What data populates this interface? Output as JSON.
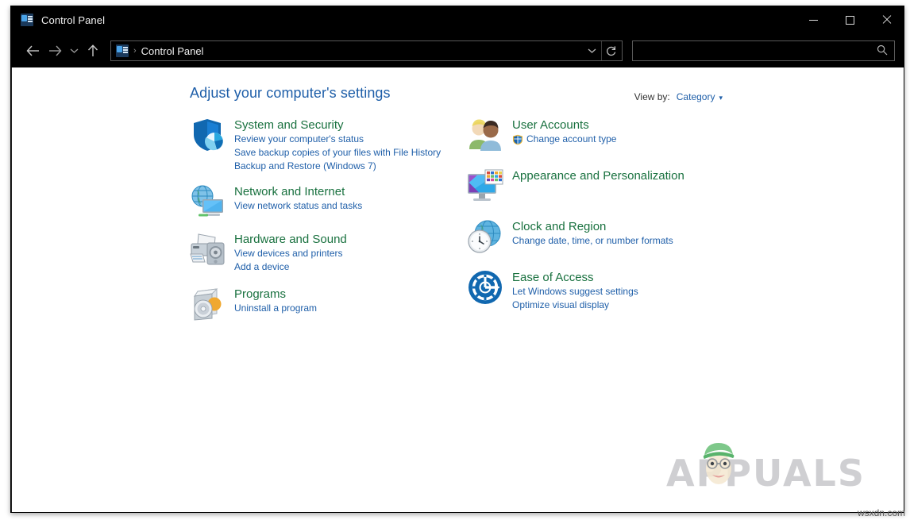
{
  "window": {
    "title": "Control Panel",
    "icon": "control-panel-icon",
    "controls": {
      "minimize": "minimize-icon",
      "maximize": "maximize-icon",
      "close": "close-icon"
    }
  },
  "nav": {
    "back": "back-arrow-icon",
    "forward": "forward-arrow-icon",
    "history": "chevron-down-icon",
    "up": "up-arrow-icon",
    "address": {
      "icon": "control-panel-icon",
      "separator": "›",
      "crumb": "Control Panel",
      "dropdown": "chevron-down-icon",
      "refresh": "refresh-icon"
    },
    "search": {
      "value": "",
      "placeholder": "",
      "icon": "search-icon"
    }
  },
  "main": {
    "heading": "Adjust your computer's settings",
    "view_by": {
      "label": "View by:",
      "value": "Category",
      "caret": "▾"
    },
    "categories_left": [
      {
        "icon": "shield-security-icon",
        "title": "System and Security",
        "links": [
          {
            "text": "Review your computer's status",
            "shield": false
          },
          {
            "text": "Save backup copies of your files with File History",
            "shield": false
          },
          {
            "text": "Backup and Restore (Windows 7)",
            "shield": false
          }
        ]
      },
      {
        "icon": "network-globe-monitor-icon",
        "title": "Network and Internet",
        "links": [
          {
            "text": "View network status and tasks",
            "shield": false
          }
        ]
      },
      {
        "icon": "printer-speaker-icon",
        "title": "Hardware and Sound",
        "links": [
          {
            "text": "View devices and printers",
            "shield": false
          },
          {
            "text": "Add a device",
            "shield": false
          }
        ]
      },
      {
        "icon": "software-box-cd-icon",
        "title": "Programs",
        "links": [
          {
            "text": "Uninstall a program",
            "shield": false
          }
        ]
      }
    ],
    "categories_right": [
      {
        "icon": "user-accounts-people-icon",
        "title": "User Accounts",
        "links": [
          {
            "text": "Change account type",
            "shield": true
          }
        ]
      },
      {
        "icon": "monitor-palette-icon",
        "title": "Appearance and Personalization",
        "links": []
      },
      {
        "icon": "globe-clock-icon",
        "title": "Clock and Region",
        "links": [
          {
            "text": "Change date, time, or number formats",
            "shield": false
          }
        ]
      },
      {
        "icon": "ease-of-access-icon",
        "title": "Ease of Access",
        "links": [
          {
            "text": "Let Windows suggest settings",
            "shield": false
          },
          {
            "text": "Optimize visual display",
            "shield": false
          }
        ]
      }
    ]
  },
  "watermark": {
    "text": "APPUALS",
    "site": "wsxdn.com"
  },
  "colors": {
    "titlebar_bg": "#000000",
    "content_bg": "#ffffff",
    "heading_blue": "#1f5fa9",
    "category_green": "#19713f",
    "link_blue": "#1f5fa9",
    "watermark_gray": "#cfcfd2"
  }
}
